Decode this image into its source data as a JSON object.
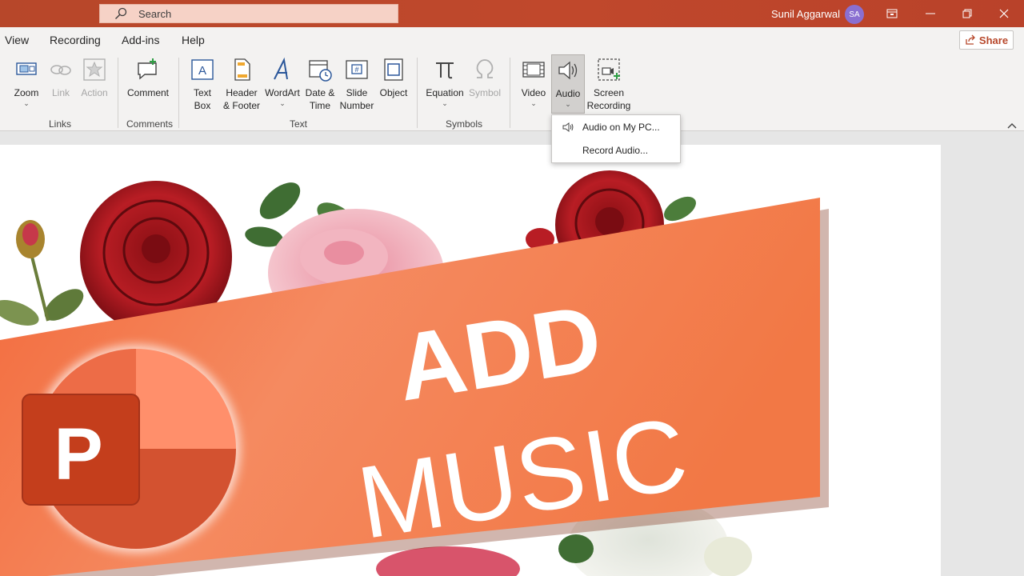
{
  "titlebar": {
    "search_placeholder": "Search",
    "user_name": "Sunil Aggarwal",
    "user_initials": "SA"
  },
  "menubar": {
    "items": [
      "View",
      "Recording",
      "Add-ins",
      "Help"
    ],
    "share_label": "Share"
  },
  "ribbon": {
    "links": {
      "zoom": "Zoom",
      "link": "Link",
      "action": "Action",
      "group": "Links"
    },
    "comments": {
      "comment": "Comment",
      "group": "Comments"
    },
    "text": {
      "text_box_1": "Text",
      "text_box_2": "Box",
      "header_1": "Header",
      "header_2": "& Footer",
      "wordart": "WordArt",
      "date_1": "Date &",
      "date_2": "Time",
      "slide_1": "Slide",
      "slide_2": "Number",
      "object": "Object",
      "group": "Text"
    },
    "symbols": {
      "equation": "Equation",
      "symbol": "Symbol",
      "group": "Symbols"
    },
    "media": {
      "video": "Video",
      "audio": "Audio",
      "screen_1": "Screen",
      "screen_2": "Recording"
    }
  },
  "audio_menu": {
    "items": [
      "Audio on My PC...",
      "Record Audio..."
    ]
  },
  "slide": {
    "banner_line1": "ADD",
    "banner_line2": "MUSIC",
    "logo_letter": "P"
  },
  "colors": {
    "accent": "#b7472a",
    "banner_start": "#f7a783",
    "banner_end": "#ef5a2a"
  }
}
